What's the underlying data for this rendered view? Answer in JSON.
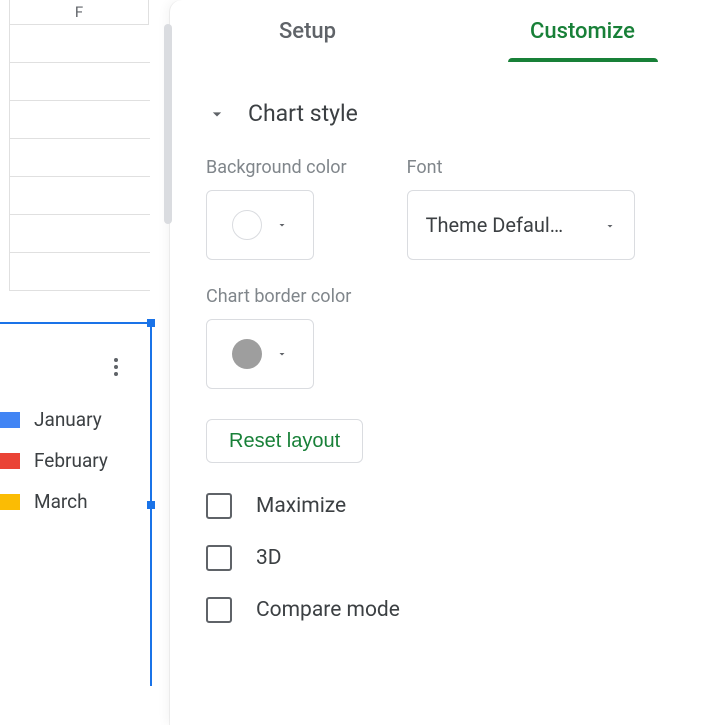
{
  "sheet": {
    "column_letter": "F"
  },
  "chart_partial": {
    "legend": [
      {
        "label": "January",
        "color": "#4285f4"
      },
      {
        "label": "February",
        "color": "#ea4335"
      },
      {
        "label": "March",
        "color": "#fbbc04"
      }
    ]
  },
  "sidepanel": {
    "tabs": {
      "setup": "Setup",
      "customize": "Customize"
    },
    "chart_style": {
      "title": "Chart style",
      "bg_label": "Background color",
      "bg_value": "#ffffff",
      "font_label": "Font",
      "font_value": "Theme Defaul…",
      "border_label": "Chart border color",
      "border_value": "#9e9e9e",
      "reset_label": "Reset layout",
      "checkboxes": {
        "maximize": "Maximize",
        "three_d": "3D",
        "compare": "Compare mode"
      }
    }
  }
}
